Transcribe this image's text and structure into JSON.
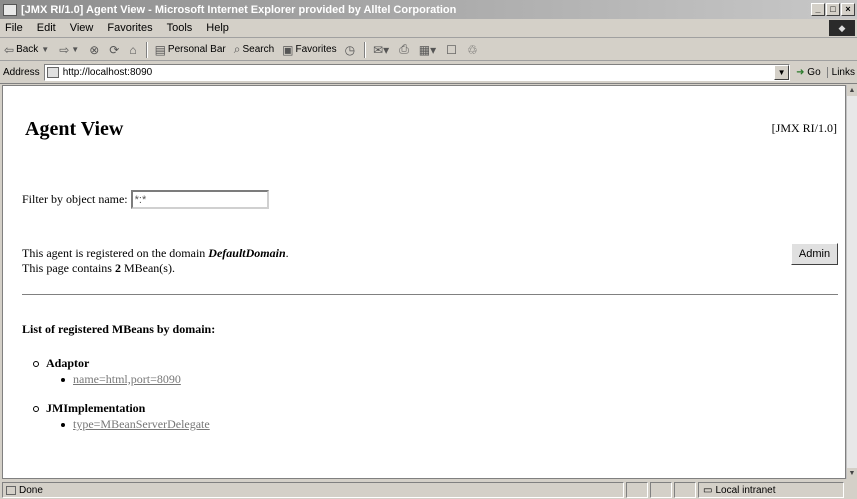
{
  "window": {
    "title": "[JMX RI/1.0] Agent View - Microsoft Internet Explorer provided by Alltel Corporation"
  },
  "menu": [
    "File",
    "Edit",
    "View",
    "Favorites",
    "Tools",
    "Help"
  ],
  "toolbar": {
    "back": "Back",
    "personal_bar": "Personal Bar",
    "search": "Search",
    "favorites": "Favorites"
  },
  "address": {
    "label": "Address",
    "url": "http://localhost:8090",
    "go": "Go",
    "links": "Links"
  },
  "page": {
    "title": "Agent View",
    "version": "[JMX RI/1.0]",
    "filter_label": "Filter by object name:",
    "filter_value": "*:*",
    "domain_text_prefix": "This agent is registered on the domain",
    "domain_name": "DefaultDomain",
    "domain_text_suffix": ".",
    "count_prefix": "This page contains",
    "count_value": "2",
    "count_suffix": "MBean(s).",
    "admin_button": "Admin",
    "list_heading": "List of registered MBeans by domain:",
    "domains": [
      {
        "name": "Adaptor",
        "mbeans": [
          "name=html,port=8090"
        ]
      },
      {
        "name": "JMImplementation",
        "mbeans": [
          "type=MBeanServerDelegate"
        ]
      }
    ]
  },
  "status": {
    "text": "Done",
    "zone": "Local intranet"
  }
}
